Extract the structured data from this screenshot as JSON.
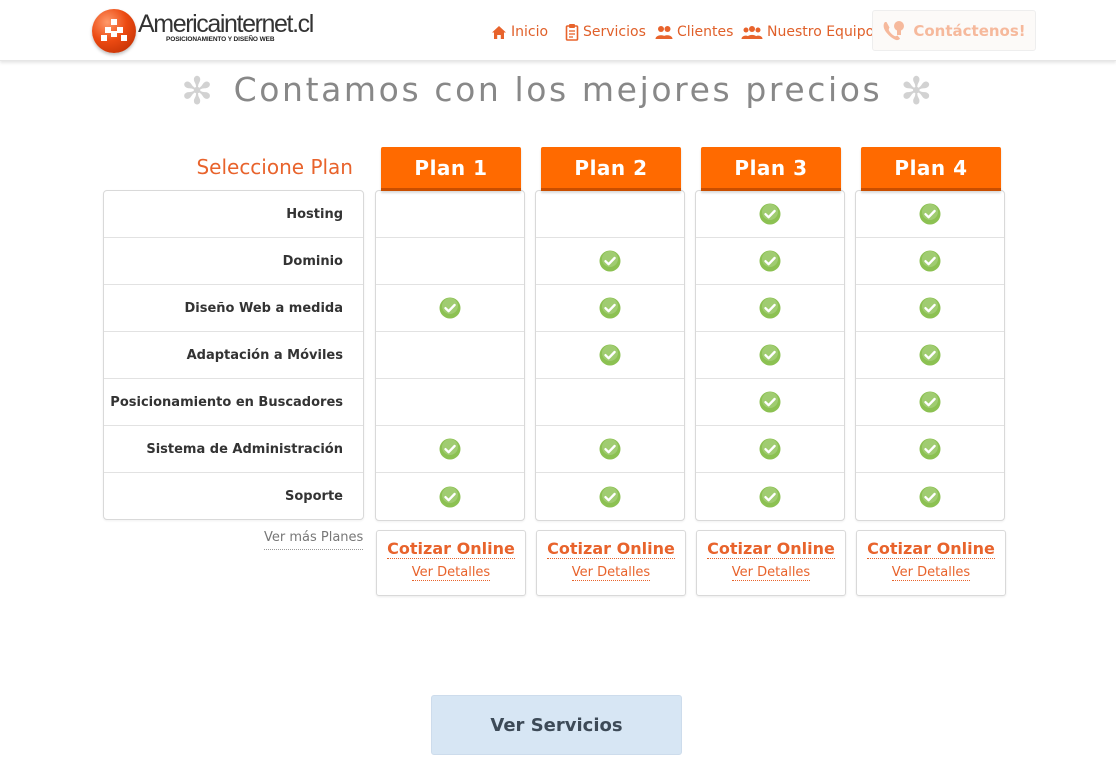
{
  "brand": {
    "name": "Americainternet.cl",
    "tagline": "POSICIONAMIENTO Y DISEÑO WEB"
  },
  "nav": {
    "items": [
      {
        "label": "Inicio",
        "icon": "home-icon"
      },
      {
        "label": "Servicios",
        "icon": "clipboard-icon"
      },
      {
        "label": "Clientes",
        "icon": "users-icon"
      },
      {
        "label": "Nuestro Equipo",
        "icon": "team-icon"
      }
    ],
    "contact_label": "Contáctenos!",
    "contact_icon": "phone-icon"
  },
  "hero": {
    "title": "Contamos con los mejores precios",
    "decoration": "✻"
  },
  "pricing": {
    "select_label": "Seleccione Plan",
    "features": [
      "Hosting",
      "Dominio",
      "Diseño Web a medida",
      "Adaptación a Móviles",
      "Posicionamiento en Buscadores",
      "Sistema de Administración",
      "Soporte"
    ],
    "plans": [
      {
        "name": "Plan 1",
        "includes": [
          false,
          false,
          true,
          false,
          false,
          true,
          true
        ],
        "quote_label": "Cotizar Online",
        "details_label": "Ver Detalles"
      },
      {
        "name": "Plan 2",
        "includes": [
          false,
          true,
          true,
          true,
          false,
          true,
          true
        ],
        "quote_label": "Cotizar Online",
        "details_label": "Ver Detalles"
      },
      {
        "name": "Plan 3",
        "includes": [
          true,
          true,
          true,
          true,
          true,
          true,
          true
        ],
        "quote_label": "Cotizar Online",
        "details_label": "Ver Detalles"
      },
      {
        "name": "Plan 4",
        "includes": [
          true,
          true,
          true,
          true,
          true,
          true,
          true
        ],
        "quote_label": "Cotizar Online",
        "details_label": "Ver Detalles"
      }
    ],
    "more_plans_label": "Ver más Planes"
  },
  "cta": {
    "services_label": "Ver Servicios"
  },
  "colors": {
    "accent": "#ff6a00",
    "link": "#e8632c",
    "check": "#8cc152",
    "cta_bg": "#d7e6f4"
  }
}
